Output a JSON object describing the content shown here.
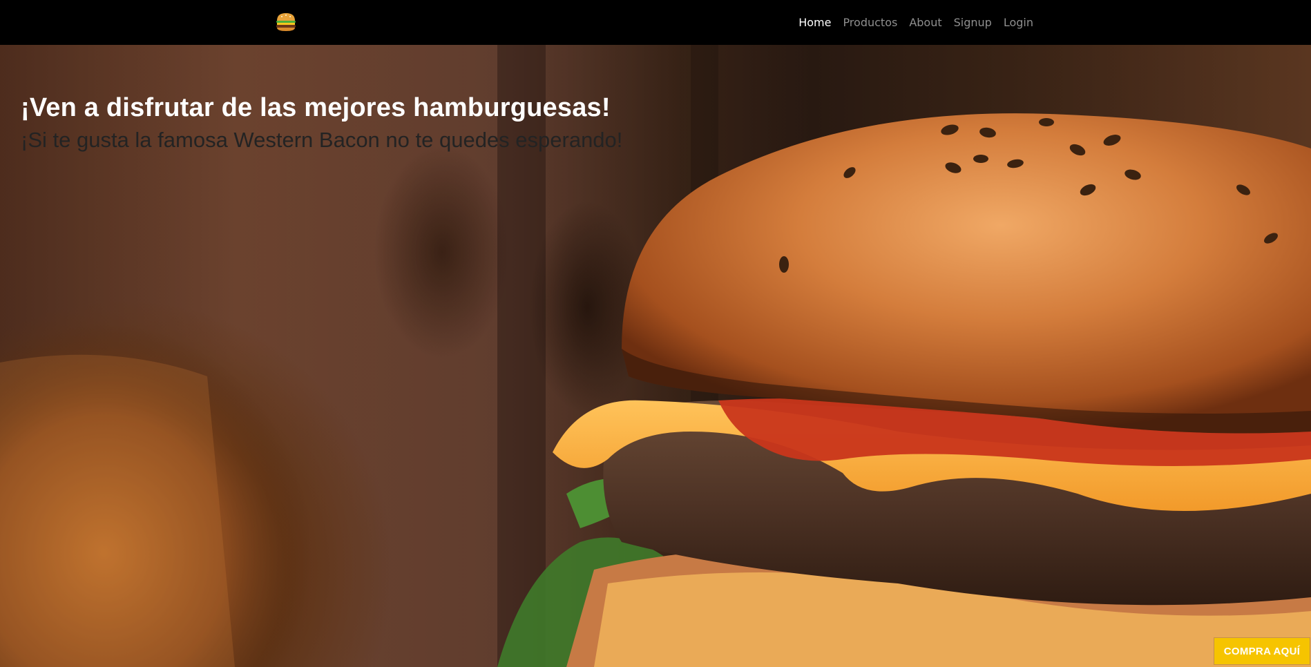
{
  "navbar": {
    "brand_icon": "hamburger-icon",
    "links": [
      {
        "label": "Home",
        "active": true
      },
      {
        "label": "Productos",
        "active": false
      },
      {
        "label": "About",
        "active": false
      },
      {
        "label": "Signup",
        "active": false
      },
      {
        "label": "Login",
        "active": false
      }
    ]
  },
  "hero": {
    "title": "¡Ven a disfrutar de las mejores hamburguesas!",
    "subtitle": "¡Si te gusta la famosa Western Bacon no te quedes esperando!",
    "background": "burger-photo"
  },
  "cta": {
    "label": "COMPRA AQUÍ",
    "color": "#f6c400"
  },
  "colors": {
    "nav_bg": "#000000",
    "nav_active": "#ffffff",
    "nav_inactive": "#8f8f8f",
    "title": "#ffffff",
    "subtitle": "#232323"
  }
}
